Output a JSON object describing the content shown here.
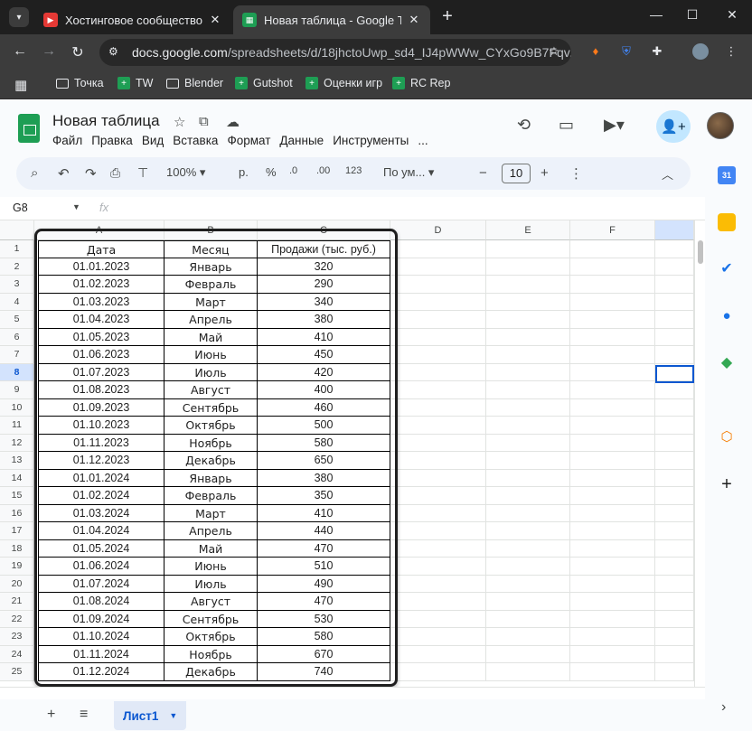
{
  "browser": {
    "tabs": [
      {
        "title": "Хостинговое сообщество «Tim",
        "favicon": "youtube-play-icon",
        "active": false
      },
      {
        "title": "Новая таблица - Google Табли",
        "favicon": "sheets-icon",
        "active": true
      }
    ],
    "url_host": "docs.google.com",
    "url_path": "/spreadsheets/d/18jhctoUwp_sd4_IJ4pWWw_CYxGo9B7Fqv...",
    "bookmarks": [
      {
        "label": "Точка",
        "icon": "folder-icon"
      },
      {
        "label": "TW",
        "icon": "sheets-icon"
      },
      {
        "label": "Blender",
        "icon": "folder-icon"
      },
      {
        "label": "Gutshot",
        "icon": "sheets-icon"
      },
      {
        "label": "Оценки игр",
        "icon": "sheets-icon"
      },
      {
        "label": "RC Rep",
        "icon": "sheets-icon"
      }
    ]
  },
  "doc": {
    "title": "Новая таблица",
    "menu": [
      "Файл",
      "Правка",
      "Вид",
      "Вставка",
      "Формат",
      "Данные",
      "Инструменты",
      "..."
    ]
  },
  "toolbar": {
    "zoom": "100%",
    "currency": "р.",
    "percent": "%",
    "dec_decrease": ".0",
    "dec_increase": ".00",
    "number_format": "123",
    "font": "По ум...",
    "font_size": "10"
  },
  "formula_bar": {
    "name_box": "G8",
    "fx": "fx"
  },
  "sheet": {
    "columns": [
      "A",
      "B",
      "C",
      "D",
      "E",
      "F"
    ],
    "rows": [
      "1",
      "2",
      "3",
      "4",
      "5",
      "6",
      "7",
      "8",
      "9",
      "10",
      "11",
      "12",
      "13",
      "14",
      "15",
      "16",
      "17",
      "18",
      "19",
      "20",
      "21",
      "22",
      "23",
      "24",
      "25"
    ],
    "selected_row": "8",
    "header": [
      "Дата",
      "Месяц",
      "Продажи (тыс. руб.)"
    ],
    "data": [
      [
        "01.01.2023",
        "Январь",
        "320"
      ],
      [
        "01.02.2023",
        "Февраль",
        "290"
      ],
      [
        "01.03.2023",
        "Март",
        "340"
      ],
      [
        "01.04.2023",
        "Апрель",
        "380"
      ],
      [
        "01.05.2023",
        "Май",
        "410"
      ],
      [
        "01.06.2023",
        "Июнь",
        "450"
      ],
      [
        "01.07.2023",
        "Июль",
        "420"
      ],
      [
        "01.08.2023",
        "Август",
        "400"
      ],
      [
        "01.09.2023",
        "Сентябрь",
        "460"
      ],
      [
        "01.10.2023",
        "Октябрь",
        "500"
      ],
      [
        "01.11.2023",
        "Ноябрь",
        "580"
      ],
      [
        "01.12.2023",
        "Декабрь",
        "650"
      ],
      [
        "01.01.2024",
        "Январь",
        "380"
      ],
      [
        "01.02.2024",
        "Февраль",
        "350"
      ],
      [
        "01.03.2024",
        "Март",
        "410"
      ],
      [
        "01.04.2024",
        "Апрель",
        "440"
      ],
      [
        "01.05.2024",
        "Май",
        "470"
      ],
      [
        "01.06.2024",
        "Июнь",
        "510"
      ],
      [
        "01.07.2024",
        "Июль",
        "490"
      ],
      [
        "01.08.2024",
        "Август",
        "470"
      ],
      [
        "01.09.2024",
        "Сентябрь",
        "530"
      ],
      [
        "01.10.2024",
        "Октябрь",
        "580"
      ],
      [
        "01.11.2024",
        "Ноябрь",
        "670"
      ],
      [
        "01.12.2024",
        "Декабрь",
        "740"
      ]
    ]
  },
  "sheet_tabs": [
    {
      "label": "Лист1",
      "active": true
    }
  ],
  "colors": {
    "accent": "#0b57d0",
    "sheets_green": "#1e9e54",
    "chrome_dark": "#1f1f1f"
  }
}
